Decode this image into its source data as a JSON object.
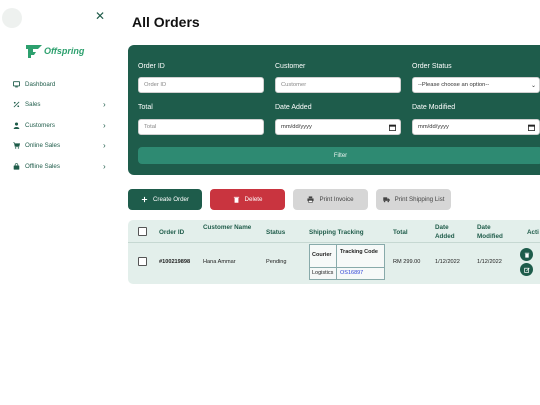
{
  "sidebar": {
    "logo_text": "Offspring",
    "items": [
      {
        "label": "Dashboard",
        "icon": "monitor-icon",
        "has_chevron": false
      },
      {
        "label": "Sales",
        "icon": "percent-icon",
        "has_chevron": true
      },
      {
        "label": "Customers",
        "icon": "user-icon",
        "has_chevron": true
      },
      {
        "label": "Online Sales",
        "icon": "cart-icon",
        "has_chevron": true
      },
      {
        "label": "Offline Sales",
        "icon": "bag-icon",
        "has_chevron": true
      }
    ]
  },
  "page": {
    "title": "All Orders"
  },
  "filter": {
    "order_id_label": "Order ID",
    "order_id_placeholder": "Order ID",
    "customer_label": "Customer",
    "customer_placeholder": "Customer",
    "status_label": "Order Status",
    "status_value": "--Please choose an option--",
    "total_label": "Total",
    "total_placeholder": "Total",
    "date_added_label": "Date Added",
    "date_added_value": "mm/dd/yyyy",
    "date_modified_label": "Date Modified",
    "date_modified_value": "mm/dd/yyyy",
    "filter_button": "Filter"
  },
  "actions": {
    "create": "Create Order",
    "delete": "Delete",
    "invoice": "Print Invoice",
    "shipping": "Print Shipping List"
  },
  "table": {
    "headers": {
      "order_id": "Order ID",
      "customer_name": "Customer Name",
      "status": "Status",
      "shipping_tracking": "Shipping Tracking",
      "total": "Total",
      "date_added": "Date Added",
      "date_modified": "Date Modified",
      "action": "Acti"
    },
    "tracking_headers": {
      "courier": "Courier",
      "code": "Tracking Code"
    },
    "rows": [
      {
        "order_id": "#100219898",
        "customer_name": "Hana Ammar",
        "status": "Pending",
        "courier": "Logistics",
        "tracking_code": "OS16897",
        "total": "RM 299.00",
        "date_added": "1/12/2022",
        "date_modified": "1/12/2022"
      }
    ]
  },
  "colors": {
    "brand": "#1e5c4b",
    "brand_light": "#2e8a72",
    "danger": "#c9343f",
    "neutral_button": "#d6d6d6",
    "table_bg": "#e3efeb",
    "logo_green": "#2da06e"
  }
}
